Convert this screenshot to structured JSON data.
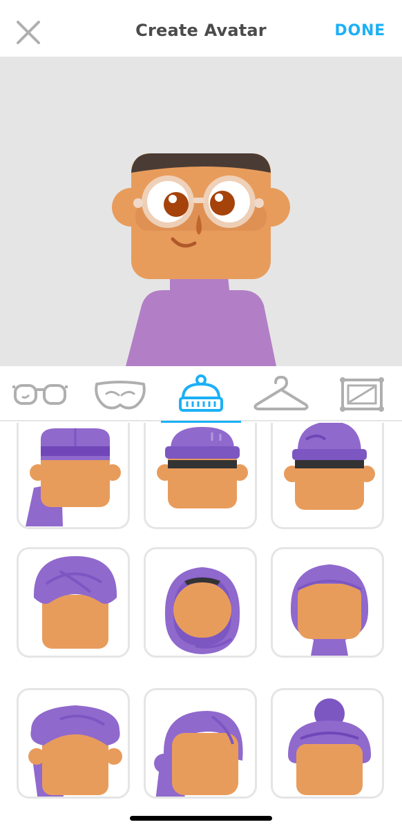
{
  "header": {
    "title": "Create Avatar",
    "done_label": "DONE",
    "close_icon": "close-icon"
  },
  "colors": {
    "accent": "#1cb0f6",
    "preview_bg": "#e5e5e5",
    "card_border": "#e5e5e5",
    "headwear_purple": "#9069cd",
    "skin": "#e89c5c",
    "shirt": "#b27fc6"
  },
  "tabs": [
    {
      "icon": "glasses-icon",
      "active": false
    },
    {
      "icon": "mustache-icon",
      "active": false
    },
    {
      "icon": "beanie-icon",
      "active": true
    },
    {
      "icon": "hanger-icon",
      "active": false
    },
    {
      "icon": "frame-icon",
      "active": false
    }
  ],
  "headwear_options": [
    "headwrap-tail",
    "beanie-cuffed",
    "beanie-tall",
    "turban-round",
    "hijab-open",
    "hijab-long",
    "turban-tail",
    "headwrap-side",
    "bun-wrap"
  ]
}
